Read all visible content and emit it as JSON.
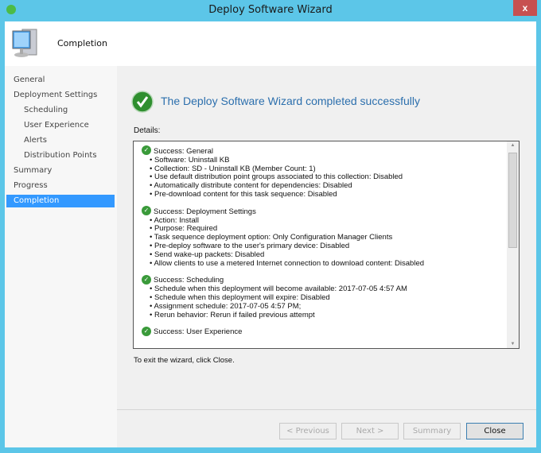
{
  "window": {
    "title": "Deploy Software Wizard",
    "close_label": "x"
  },
  "header": {
    "title": "Completion"
  },
  "sidebar": {
    "items": [
      {
        "label": "General"
      },
      {
        "label": "Deployment Settings"
      },
      {
        "label": "Scheduling"
      },
      {
        "label": "User Experience"
      },
      {
        "label": "Alerts"
      },
      {
        "label": "Distribution Points"
      },
      {
        "label": "Summary"
      },
      {
        "label": "Progress"
      },
      {
        "label": "Completion",
        "selected": true
      }
    ]
  },
  "main": {
    "headline": "The Deploy Software Wizard completed successfully",
    "details_label": "Details:",
    "sections": [
      {
        "title": "Success: General",
        "items": [
          "Software: Uninstall KB",
          "Collection: SD - Uninstall KB (Member Count: 1)",
          "Use default distribution point groups associated to this collection: Disabled",
          "Automatically distribute content for dependencies: Disabled",
          "Pre-download content for this task sequence: Disabled"
        ]
      },
      {
        "title": "Success: Deployment Settings",
        "items": [
          "Action: Install",
          "Purpose: Required",
          "Task sequence deployment option: Only Configuration Manager Clients",
          "Pre-deploy software to the user's primary device: Disabled",
          "Send wake-up packets: Disabled",
          "Allow clients to use a metered Internet connection to download content: Disabled"
        ]
      },
      {
        "title": "Success: Scheduling",
        "items": [
          "Schedule when this deployment will become available: 2017-07-05 4:57 AM",
          "Schedule when this deployment will expire: Disabled",
          "Assignment schedule: 2017-07-05 4:57 PM;",
          "Rerun behavior: Rerun if failed previous attempt"
        ]
      },
      {
        "title": "Success: User Experience",
        "items": []
      }
    ],
    "exit_text": "To exit the wizard, click Close."
  },
  "buttons": {
    "previous": "< Previous",
    "next": "Next >",
    "summary": "Summary",
    "close": "Close"
  },
  "colors": {
    "border": "#5cc6e8",
    "selected": "#3399ff",
    "headline": "#2c6fad",
    "success": "#3a9a3a"
  }
}
